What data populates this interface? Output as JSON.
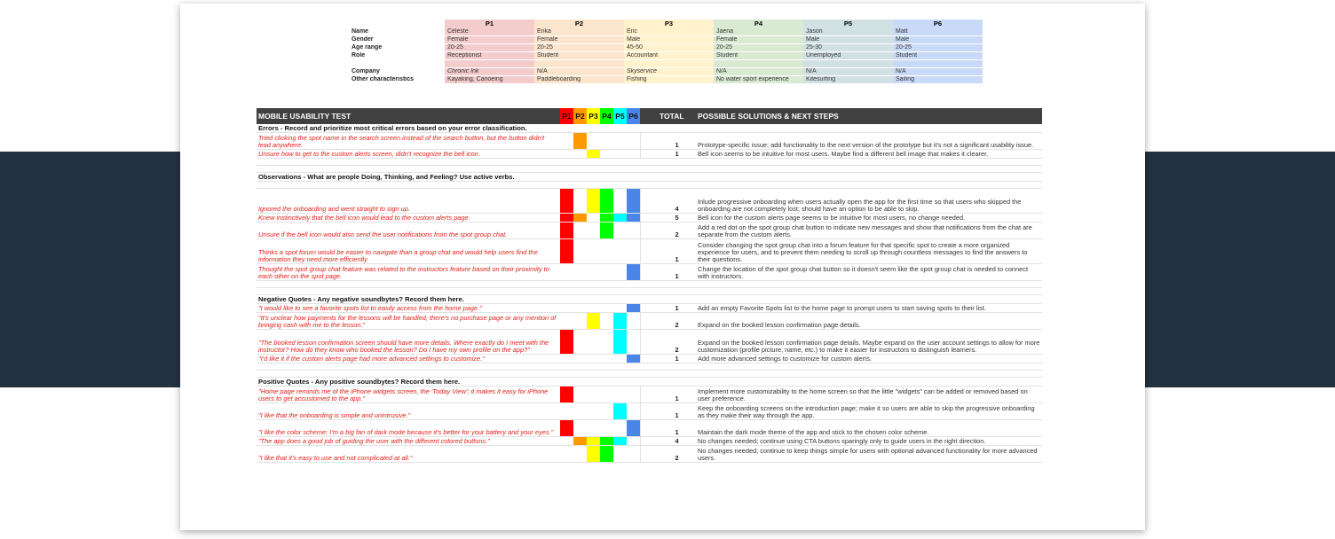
{
  "participants": {
    "headers": [
      "P1",
      "P2",
      "P3",
      "P4",
      "P5",
      "P6"
    ],
    "colors": [
      "#f4cccc",
      "#fce5cd",
      "#fff2cc",
      "#d9ead3",
      "#d0e0e3",
      "#c9daf8"
    ],
    "rows": [
      {
        "label": "Name",
        "values": [
          "Celeste",
          "Erika",
          "Eric",
          "Jaena",
          "Jason",
          "Matt"
        ]
      },
      {
        "label": "Gender",
        "values": [
          "Female",
          "Female",
          "Male",
          "Female",
          "Male",
          "Male"
        ]
      },
      {
        "label": "Age range",
        "values": [
          "20-25",
          "20-25",
          "45-50",
          "20-25",
          "25-30",
          "20-25"
        ]
      },
      {
        "label": "Role",
        "values": [
          "Receptionist",
          "Student",
          "Accountant",
          "Student",
          "Unemployed",
          "Student"
        ]
      },
      {
        "label": "",
        "values": [
          "",
          "",
          "",
          "",
          "",
          ""
        ]
      },
      {
        "label": "Company",
        "values": [
          "Chronic Ink",
          "N/A",
          "Skyservice",
          "N/A",
          "N/A",
          "N/A"
        ]
      },
      {
        "label": "Other characteristics",
        "values": [
          "Kayaking, Canoeing",
          "Paddleboarding",
          "Fishing",
          "No water sport experience",
          "Kitesurfing",
          "Sailing"
        ]
      }
    ]
  },
  "test": {
    "title": "MOBILE USABILITY TEST",
    "p_labels": [
      "P1",
      "P2",
      "P3",
      "P4",
      "P5",
      "P6"
    ],
    "p_colors": [
      "#ff0000",
      "#ff9900",
      "#ffff00",
      "#00ff00",
      "#00ffff",
      "#4a86e8"
    ],
    "total_label": "TOTAL",
    "solutions_label": "POSSIBLE SOLUTIONS & NEXT STEPS",
    "sections": [
      {
        "title": "Errors - Record and prioritize most critical errors based on your error classification.",
        "rows": [
          {
            "note": "Tried clicking the spot name in the search screen instead of the search button, but the button didn't lead anywhere.",
            "marks": [
              0,
              1,
              0,
              0,
              0,
              0
            ],
            "total": "1",
            "solution": "Prototype-specific issue; add functionality to the next version of the prototype but it's not a significant usability issue.",
            "h": 2
          },
          {
            "note": "Unsure how to get to the custom alerts screen, didn't recognize the bell icon.",
            "marks": [
              0,
              0,
              1,
              0,
              0,
              0
            ],
            "total": "1",
            "solution": "Bell icon seems to be intuitive for most users. Maybe find a different bell image that makes it clearer.",
            "h": 1
          }
        ]
      },
      {
        "title": "Observations - What are people Doing, Thinking, and Feeling? Use active verbs.",
        "rows": [
          {
            "note": "Ignored the onboarding and went straight to sign up.",
            "marks": [
              1,
              0,
              1,
              1,
              0,
              1
            ],
            "total": "4",
            "solution": "Inlude progressive onboarding when users actually open the app for the first time so that users who skipped the onboarding are not completely lost; should have an option to be able to skip.",
            "h": 3
          },
          {
            "note": "Knew instinctively that the bell icon would lead to the custom alerts page.",
            "marks": [
              1,
              1,
              0,
              1,
              1,
              1
            ],
            "total": "5",
            "solution": "Bell icon for the custom alerts page seems to be intuitive for most users, no change needed.",
            "h": 1
          },
          {
            "note": "Unsure if the bell icon would also send the user notifications from the spot group chat.",
            "marks": [
              1,
              0,
              0,
              1,
              0,
              0
            ],
            "total": "2",
            "solution": "Add a red dot on the spot group chat button to indicate new messages and show that notifications from the chat are separate from the custom alerts.",
            "h": 2
          },
          {
            "note": "Thinks a spot forum would be easier to navigate than a group chat and would help users find the information they need more efficiently.",
            "marks": [
              1,
              0,
              0,
              0,
              0,
              0
            ],
            "total": "1",
            "solution": "Consider changing the spot group chat into a forum feature for that specific spot to create a more organized experience for users, and to prevent them needing to scroll up through countless messages to find the answers to their questions.",
            "h": 3
          },
          {
            "note": "Thought the spot group chat feature was related to the instructors feature based on their proximity to each other on the spot page.",
            "marks": [
              0,
              0,
              0,
              0,
              0,
              1
            ],
            "total": "1",
            "solution": "Change the location of the spot group chat button so it doesn't seem like the spot group chat is needed to connect with instructors.",
            "h": 2
          }
        ]
      },
      {
        "title": "Negative Quotes - Any negative soundbytes? Record them here.",
        "rows": [
          {
            "note": "\"I would like to see a favorite spots list to easily access from the home page.\"",
            "marks": [
              0,
              0,
              0,
              0,
              0,
              1
            ],
            "total": "1",
            "solution": "Add an empty Favorite Spots list to the home page to prompt users to start saving spots to their list.",
            "h": 1
          },
          {
            "note": "\"It's unclear how payments for the lessons will be handled; there's no purchase page or any mention of bringing cash with me to the lesson.\"",
            "marks": [
              0,
              0,
              1,
              0,
              1,
              0
            ],
            "total": "2",
            "solution": "Expand on the booked lesson confirmation page details.",
            "h": 2
          },
          {
            "note": "\"The booked lesson confirmation screen should have more details. Where exactly do I meet with the instructor? How do they know who booked the lesson? Do I have my own profile on the app?\"",
            "marks": [
              1,
              0,
              0,
              0,
              1,
              0
            ],
            "total": "2",
            "solution": "Expand on the booked lesson confirmation page details. Maybe expand on the user account settings to allow for more customization (profile picture, name, etc.) to make it easier for instructors to distinguish learners.",
            "h": 3
          },
          {
            "note": "\"I'd like it if the custom alerts page had more advanced settings to customize.\"",
            "marks": [
              0,
              0,
              0,
              0,
              0,
              1
            ],
            "total": "1",
            "solution": "Add more advanced settings to customize for custom alerts.",
            "h": 1
          }
        ]
      },
      {
        "title": "Positive Quotes - Any positive soundbytes? Record them here.",
        "rows": [
          {
            "note": "\"Home page reminds me of the iPhone widgets screen, the 'Today View'; it makes it easy for iPhone users to get accustomed to the app.\"",
            "marks": [
              1,
              0,
              0,
              0,
              0,
              0
            ],
            "total": "1",
            "solution": "Implement more customizability to the home screen so that the little \"widgets\" can be added or removed based on user preference.",
            "h": 2
          },
          {
            "note": "\"I like that the onboarding is simple and unintrusive.\"",
            "marks": [
              0,
              0,
              0,
              0,
              1,
              0
            ],
            "total": "1",
            "solution": "Keep the onboarding screens on the introduction page; make it so users are able to skip the progressive onboarding as they make their way through the app.",
            "h": 2
          },
          {
            "note": "\"I like the color scheme; I'm a big fan of dark mode because it's better for your battery and your eyes.\"",
            "marks": [
              1,
              0,
              0,
              0,
              0,
              1
            ],
            "total": "1",
            "solution": "Maintain the dark mode theme of the app and stick to the chosen color scheme.",
            "h": 2
          },
          {
            "note": "\"The app does a good job of guiding the user with the different colored buttons.\"",
            "marks": [
              0,
              1,
              1,
              1,
              1,
              0
            ],
            "total": "4",
            "solution": "No changes needed; continue using CTA buttons sparingly only to guide users in the right direction.",
            "h": 1
          },
          {
            "note": "\"I like that it's easy to use and not complicated at all.\"",
            "marks": [
              0,
              0,
              1,
              1,
              0,
              0
            ],
            "total": "2",
            "solution": "No changes needed; continue to keep things simple for users with optional advanced functionality for more advanced users.",
            "h": 2
          }
        ]
      }
    ]
  }
}
